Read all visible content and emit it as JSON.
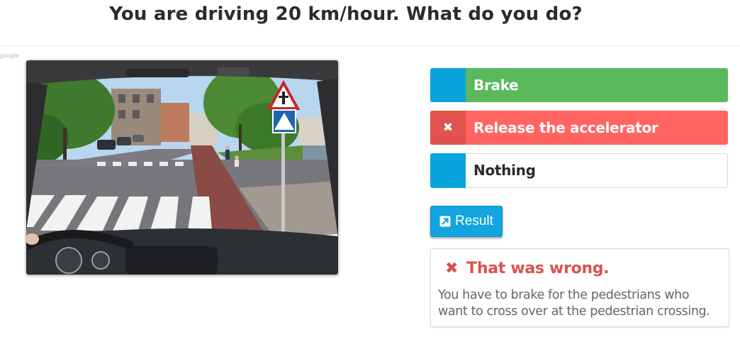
{
  "question": "You are driving 20 km/hour. What do you do?",
  "image_credit": "google",
  "answers": [
    {
      "label": "Brake",
      "state": "correct"
    },
    {
      "label": "Release the accelerator",
      "state": "wrong",
      "marker": "✖"
    },
    {
      "label": "Nothing",
      "state": "neutral"
    }
  ],
  "result_button": {
    "label": "Result",
    "icon": "external-link-icon"
  },
  "feedback": {
    "icon": "cross-icon",
    "title": "That was wrong.",
    "explanation": "You have to brake for the pedestrians who want to cross over at the pedestrian crossing."
  },
  "colors": {
    "correct": "#5cb85c",
    "wrong": "#ff6461",
    "marker_blue": "#0aa4dc",
    "error_text": "#d9534f"
  }
}
